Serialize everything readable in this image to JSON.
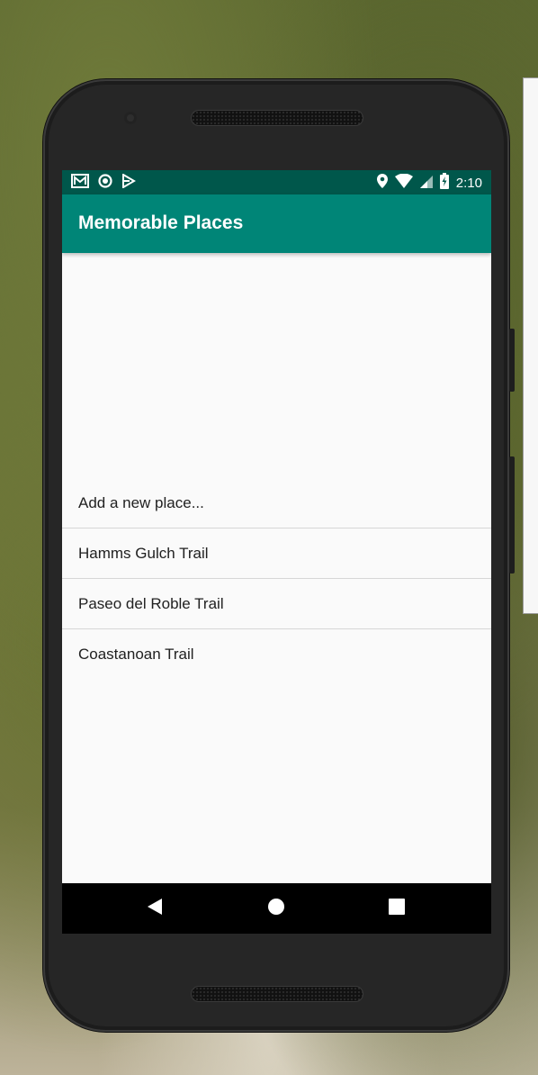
{
  "app": {
    "title": "Memorable Places"
  },
  "status_bar": {
    "left_icons": [
      "gmail-icon",
      "sync-icon",
      "play-store-icon"
    ],
    "right_icons": [
      "location-icon",
      "wifi-icon",
      "signal-icon",
      "battery-charging-icon"
    ],
    "time": "2:10"
  },
  "places": [
    {
      "label": "Add a new place..."
    },
    {
      "label": "Hamms Gulch Trail"
    },
    {
      "label": "Paseo del Roble Trail"
    },
    {
      "label": "Coastanoan Trail"
    }
  ],
  "nav_bar": {
    "buttons": [
      "back-icon",
      "home-icon",
      "recents-icon"
    ]
  },
  "colors": {
    "status_bar": "#00574b",
    "app_bar": "#008577",
    "screen_bg": "#fafafa"
  }
}
